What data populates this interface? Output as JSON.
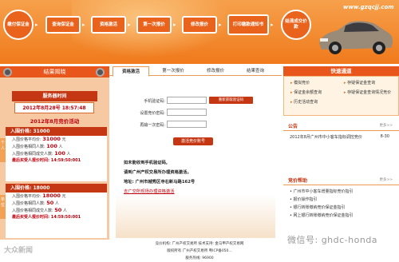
{
  "header": {
    "site_url": "www.gzqcjj.com",
    "steps": [
      "缴付保证金",
      "查询保证金",
      "资格激活",
      "第一次报价",
      "修改报价",
      "打印缴款通知书",
      "结清成交价款"
    ]
  },
  "left": {
    "title": "结果揭晓",
    "server_title": "服务器时间",
    "server_time": "2012年8月28号 18:57:48",
    "activity_title": "2012年8月竞价活动",
    "groups": [
      {
        "side": "个人",
        "title": "入围价格: 31000",
        "rows": [
          {
            "label": "入围价格平均价: ",
            "value": "31000",
            "unit": " 元"
          },
          {
            "label": "入围价格相同人数: ",
            "value": "100",
            "unit": " 人"
          },
          {
            "label": "入围价格相同成交人数: ",
            "value": "100",
            "unit": " 人"
          },
          {
            "label": "最后买受人报价时间: ",
            "value": "14:59:50:001",
            "unit": ""
          }
        ]
      },
      {
        "side": "单位",
        "title": "入围价格: 18000",
        "rows": [
          {
            "label": "入围价格平均价: ",
            "value": "18000",
            "unit": " 元"
          },
          {
            "label": "入围价格相同人数: ",
            "value": "50",
            "unit": " 人"
          },
          {
            "label": "入围价格相同成交人数: ",
            "value": "50",
            "unit": " 人"
          },
          {
            "label": "最后买受人报价时间: ",
            "value": "14:59:50:001",
            "unit": ""
          }
        ]
      }
    ]
  },
  "center": {
    "tabs": [
      "资格激活",
      "第一次报价",
      "修改报价",
      "结果查询"
    ],
    "form": {
      "phone_label": "手机验证码:",
      "get_code_button": "重新获取验证码",
      "set_pwd_label": "设置竞价密码:",
      "confirm_pwd_label": "再输一次密码:",
      "submit_button": "激活竞价账号"
    },
    "notes": [
      "如未能收到手机验证码,",
      "请到广州产权交易所办理资格激活。",
      "地址: 广州市越秀区寺右新马路162号"
    ],
    "doc_link": "去广交所现场办理资格激活"
  },
  "right": {
    "quick_title": "快速通道",
    "quick_links": [
      "模拟竞价",
      "存疑保证金查询",
      "保证金余额查询",
      "存疑保证金查询情况竞价",
      "历史活动查询"
    ],
    "announce_title": "公告",
    "more": "更多>>",
    "announcements": [
      {
        "text": "2012年8月广州市中小客车指标调控竞价",
        "date": "8-30"
      }
    ],
    "docs_title": "竞价帮助",
    "docs": [
      "广州市中小客车增量指标竞价指引",
      "报价操作指引",
      "银行转账缴纳竞价保证金指引",
      "网上银行转账缴纳竞价保证金指引"
    ]
  },
  "footer": {
    "line1": "竞价机构: 广州产权交易所  技术支持: 金马甲产权交易网",
    "line2": "版权所有 广州产权交易所  粤ICP备050...",
    "line3": "服务热线: 96900"
  },
  "watermarks": {
    "left": "大众新闻",
    "right": "微信号: ghdc-honda"
  }
}
